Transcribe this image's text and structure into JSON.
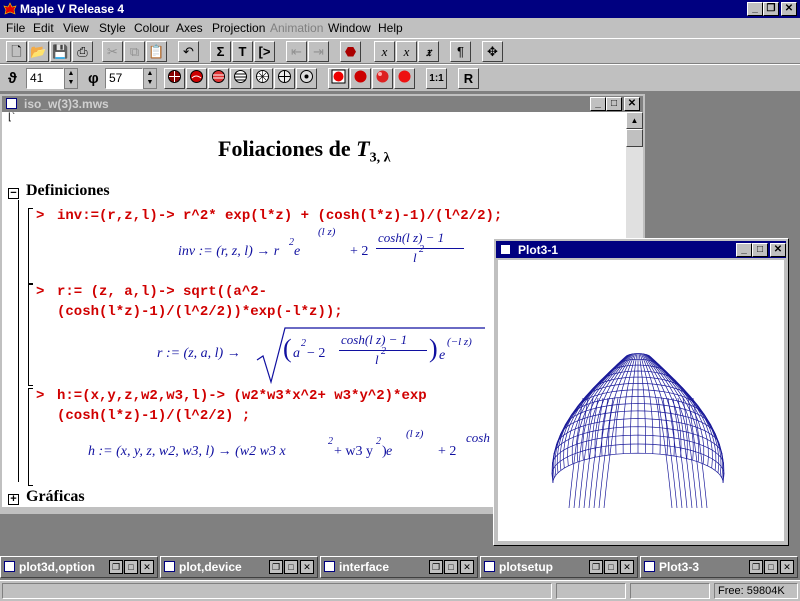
{
  "window": {
    "title": "Maple V Release 4"
  },
  "menu": [
    "File",
    "Edit",
    "View",
    "Style",
    "Colour",
    "Axes",
    "Projection",
    "Animation",
    "Window",
    "Help"
  ],
  "toolbar2": {
    "theta_symbol": "ϑ",
    "theta_value": "41",
    "phi_symbol": "φ",
    "phi_value": "57",
    "ratio_label": "1:1",
    "r_label": "R"
  },
  "document": {
    "title": "iso_w(3)3.mws",
    "heading": "Foliaciones de ",
    "heading_T": "T",
    "heading_sub": "3, λ",
    "section1": "Definiciones",
    "section2": "Gráficas",
    "prompt": ">",
    "input1": "inv:=(r,z,l)-> r^2* exp(l*z) + (cosh(l*z)-1)/(l^2/2);",
    "input2a": "r:= (z, a,l)-> sqrt((a^2-",
    "input2b": "(cosh(l*z)-1)/(l^2/2))*exp(-l*z));",
    "input3a": "h:=(x,y,z,w2,w3,l)-> (w2*w3*x^2+ w3*y^2)*exp",
    "input3b": "(cosh(l*z)-1)/(l^2/2) ;",
    "out1": {
      "lhs": "inv := (r, z, l) → r",
      "exp2": "2",
      "e": " e",
      "expo": "(l z)",
      "plus": "+ 2",
      "num": "cosh(l z) − 1",
      "den": "l",
      "den_exp": "2"
    },
    "out2": {
      "lhs": "r := (z, a, l) →",
      "a": "a",
      "a_exp": "2",
      "minus": " − 2",
      "num": "cosh(l z) − 1",
      "den": "l",
      "den_exp": "2",
      "e": "e",
      "expo": "(−l z)"
    },
    "out3": {
      "lhs": "h := (x, y, z, w2, w3, l) → (w2 w3 x",
      "x_exp": "2",
      "mid": " + w3 y",
      "y_exp": "2",
      "close": ")",
      "e": " e",
      "expo": "(l z)",
      "plus": "+ 2",
      "num": "cosh"
    }
  },
  "plot": {
    "title": "Plot3-1",
    "line_color": "#1a1a9a"
  },
  "taskbar": [
    "plot3d,option",
    "plot,device",
    "interface",
    "plotsetup",
    "Plot3-3"
  ],
  "status": {
    "free": "Free:  59804K"
  }
}
